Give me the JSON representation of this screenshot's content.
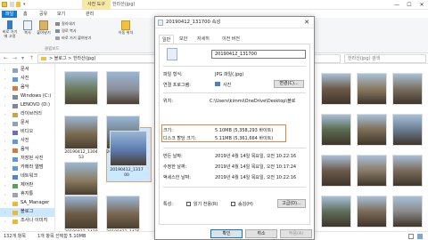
{
  "window": {
    "title": "한라산(jpg)",
    "contextual_tab": "사진 도구",
    "min": "—",
    "max": "☐",
    "close": "✕"
  },
  "tabs": {
    "file": "파일",
    "home": "홈",
    "share": "공유",
    "view": "보기",
    "manage": "관리"
  },
  "ribbon": {
    "pin": "바로 가기에 고정",
    "copy": "복사",
    "paste": "붙여넣기",
    "cut": "잘라내기",
    "copy_path": "경로 복사",
    "paste_shortcut": "바로 가기 붙여넣기",
    "move_to": "이동 위치",
    "group_clipboard": "클립보드"
  },
  "address": {
    "path": "> 블로그 > 한라산(jpg)",
    "search_placeholder": "한라산(jpg) 검색"
  },
  "sidebar": {
    "items": [
      {
        "label": "문서",
        "icon": "documents-icon"
      },
      {
        "label": "사진",
        "icon": "pictures-icon"
      },
      {
        "label": "음악",
        "icon": "music-icon"
      },
      {
        "label": "Windows (C:)",
        "icon": "drive-icon"
      },
      {
        "label": "LENOVO (D:)",
        "icon": "drive-icon"
      },
      {
        "label": "라이브러리",
        "icon": "library-icon"
      },
      {
        "label": "문서",
        "icon": "documents-icon"
      },
      {
        "label": "비디오",
        "icon": "video-icon"
      },
      {
        "label": "사진",
        "icon": "pictures-icon"
      },
      {
        "label": "음악",
        "icon": "music-icon"
      },
      {
        "label": "저장된 사진",
        "icon": "pictures-icon"
      },
      {
        "label": "카메라 앨범",
        "icon": "pictures-icon"
      },
      {
        "label": "네트워크",
        "icon": "network-icon"
      },
      {
        "label": "제어판",
        "icon": "control-panel-icon"
      },
      {
        "label": "휴지통",
        "icon": "recycle-bin-icon"
      },
      {
        "label": "SA_Manager",
        "icon": "folder-icon"
      },
      {
        "label": "블로그",
        "icon": "folder-icon"
      },
      {
        "label": "조사나 이미지",
        "icon": "folder-icon"
      }
    ]
  },
  "thumbnails": [
    {
      "caption": "",
      "color": "#6a7a5a"
    },
    {
      "caption": "",
      "color": "#8a8f99"
    },
    {
      "caption": "20190412_1304 53",
      "color": "#7a6a50"
    },
    {
      "caption": "20190412_1305 20",
      "color": "#6d7f88"
    },
    {
      "caption": "",
      "color": "#8c7c60"
    },
    {
      "caption": "20190412_1317 00",
      "color": "#5b7bb0"
    },
    {
      "caption": "20190412_1418 44",
      "color": "#6b5a44"
    },
    {
      "caption": "20190412_1425 18",
      "color": "#7a6650"
    }
  ],
  "right_thumbs": [
    {
      "caption": "",
      "color": "#6c5a48"
    },
    {
      "caption": "",
      "color": "#8a7a60"
    },
    {
      "caption": "",
      "color": "#7a7060"
    },
    {
      "caption": "",
      "color": "#5a6a50"
    },
    {
      "caption": "",
      "color": "#7d6d55"
    },
    {
      "caption": "",
      "color": "#6a7d90"
    },
    {
      "caption": "",
      "color": "#6a5a4a"
    },
    {
      "caption": "",
      "color": "#8a7a68"
    },
    {
      "caption": "",
      "color": "#796b5a"
    },
    {
      "caption": "",
      "color": "#5e6e58"
    },
    {
      "caption": "",
      "color": "#7b6a58"
    },
    {
      "caption": "",
      "color": "#8a8a8a"
    }
  ],
  "status": {
    "count": "132개 항목",
    "selected": "1개 항목 선택함 5.10MB"
  },
  "dialog": {
    "title": "20190412_131700 속성",
    "tabs": [
      "일반",
      "보안",
      "자세히",
      "이전 버전"
    ],
    "filename": "20190412_131700",
    "file_type_label": "파일 형식:",
    "file_type_value": "JPG 파일(.jpg)",
    "opens_with_label": "연결 프로그램:",
    "opens_with_value": "사진",
    "change_button": "변경(C)...",
    "location_label": "위치:",
    "location_value": "C:\\Users\\kimmi\\OneDrive\\Desktop\\블로",
    "size_label": "크기:",
    "size_value": "5.10MB (5,358,293 바이트)",
    "size_on_disk_label": "디스크 할당 크기:",
    "size_on_disk_value": "5.11MB (5,361,664 바이트)",
    "created_label": "만든 날짜:",
    "created_value": "2019년 4월 14일 목요일, 오전 10:22:16",
    "modified_label": "수정한 날짜:",
    "modified_value": "2019년 4월 14일 목요일, 오전 10:17:24",
    "accessed_label": "액세스한 날짜:",
    "accessed_value": "2019년 4월 14일 목요일, 오전 10:22:16",
    "attributes_label": "특성:",
    "readonly_label": "읽기 전용(R)",
    "hidden_label": "숨김(H)",
    "advanced_button": "고급(D)...",
    "ok": "확인",
    "cancel": "취소",
    "apply": "적용(A)",
    "highlight_color": "#e8823a"
  }
}
